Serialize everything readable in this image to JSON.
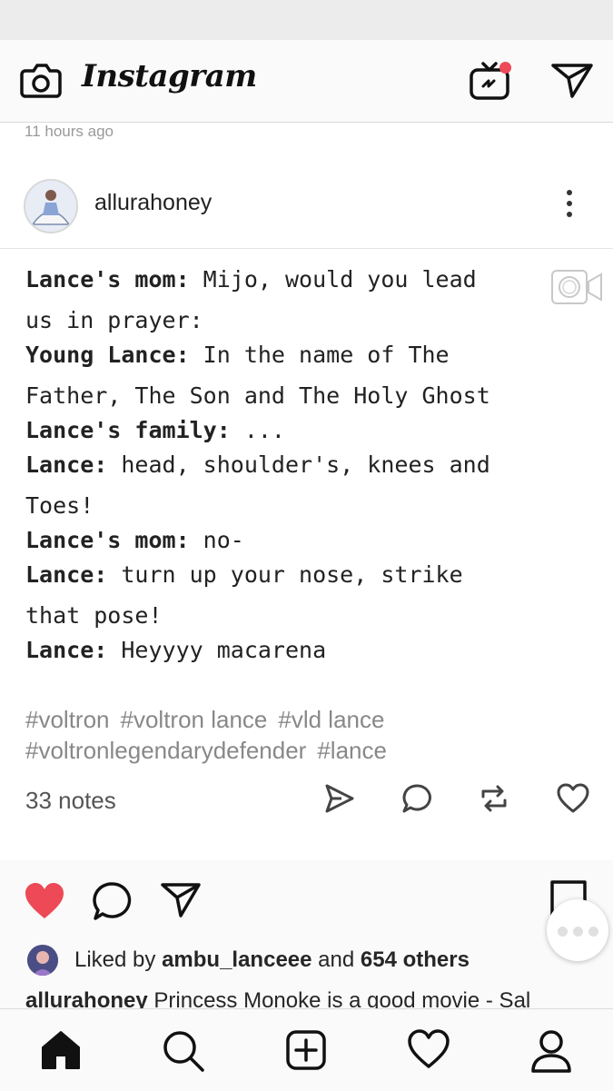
{
  "app": {
    "logo": "Instagram"
  },
  "post": {
    "timestamp": "11 hours ago",
    "tumblr": {
      "username": "allurahoney",
      "dialog": [
        {
          "speaker": "Lance's mom:",
          "text": " Mijo, would you lead"
        },
        {
          "speaker": "",
          "text": "us in prayer:"
        },
        {
          "speaker": "Young Lance:",
          "text": " In the name of The"
        },
        {
          "speaker": "",
          "text": "Father, The Son and The Holy Ghost"
        },
        {
          "speaker": "Lance's family:",
          "text": " ..."
        },
        {
          "speaker": "Lance:",
          "text": " head, shoulder's, knees and"
        },
        {
          "speaker": "",
          "text": "Toes!"
        },
        {
          "speaker": "Lance's mom:",
          "text": " no-"
        },
        {
          "speaker": "Lance:",
          "text": " turn up your nose, strike"
        },
        {
          "speaker": "",
          "text": "that pose!"
        },
        {
          "speaker": "Lance:",
          "text": " Heyyyy macarena"
        }
      ],
      "tags": [
        "#voltron",
        "#voltron lance",
        "#vld lance",
        "#voltronlegendarydefender",
        "#lance"
      ],
      "notes": "33 notes"
    },
    "liked_by_prefix": "Liked by ",
    "liked_by_user": "ambu_lanceee",
    "liked_by_mid": " and ",
    "liked_by_count": "654 others",
    "caption_user": "allurahoney",
    "caption_text": " Princess Monoke is a good movie - Sal"
  },
  "colors": {
    "like": "#ed4956",
    "notification_dot": "#ed4956"
  },
  "icons": {
    "top": [
      "camera-icon",
      "igtv-icon",
      "direct-icon"
    ],
    "tumblr_actions": [
      "share-icon",
      "reply-icon",
      "reblog-icon",
      "like-icon"
    ],
    "post_actions": [
      "heart-icon",
      "comment-icon",
      "share-icon",
      "bookmark-icon"
    ],
    "bottom_nav": [
      "home-icon",
      "search-icon",
      "add-post-icon",
      "activity-icon",
      "profile-icon"
    ]
  }
}
